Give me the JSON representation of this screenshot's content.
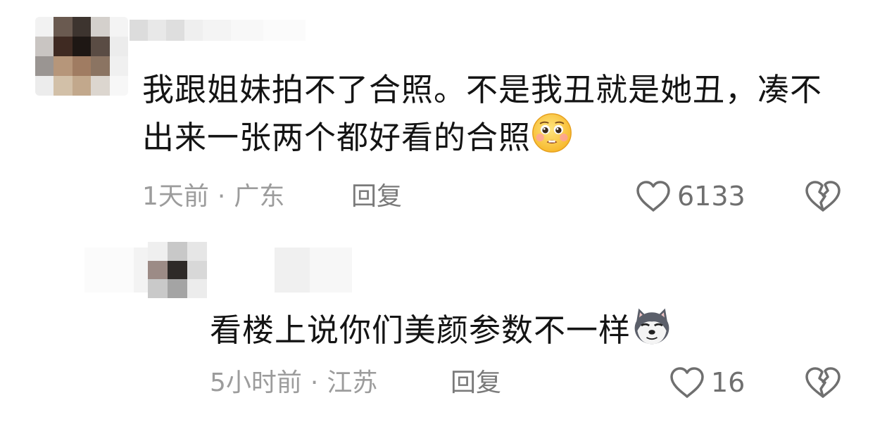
{
  "comments": [
    {
      "text": "我跟姐妹拍不了合照。不是我丑就是她丑，凑不出来一张两个都好看的合照",
      "emoji": "pleading-face-emoji",
      "time": "1天前",
      "location": "广东",
      "reply_label": "回复",
      "like_count": "6133"
    },
    {
      "text": "看楼上说你们美颜参数不一样",
      "emoji": "husky-dog-emoji",
      "time": "5小时前",
      "location": "江苏",
      "reply_label": "回复",
      "like_count": "16"
    }
  ],
  "meta_separator": "·",
  "colors": {
    "text": "#141414",
    "meta": "#9c9c9c",
    "icon": "#6f6f6f",
    "background": "#ffffff"
  }
}
